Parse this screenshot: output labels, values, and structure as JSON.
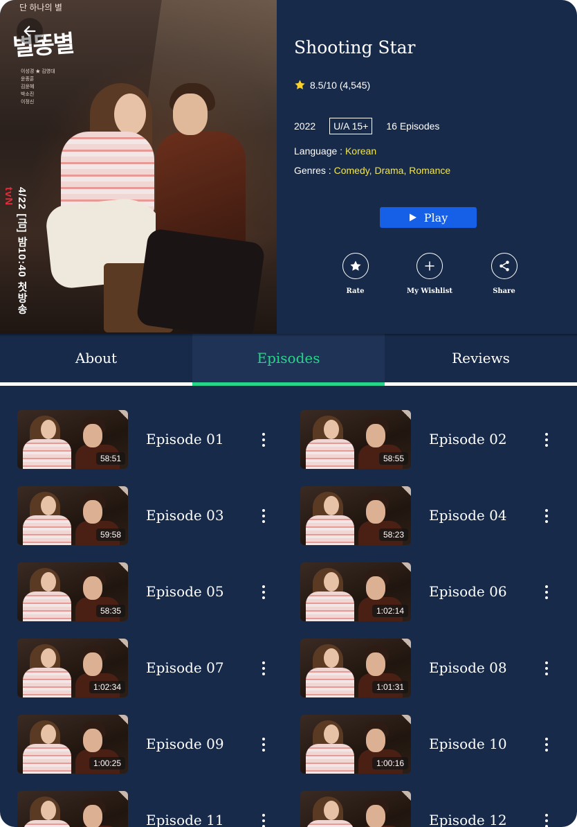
{
  "poster": {
    "top_text": "단 하나의 별",
    "logo_text": "별똥별",
    "cast": [
      "이성경 ★ 김영대",
      "윤종훈",
      "김윤혜",
      "박소진",
      "이정신"
    ],
    "air_date": "4/22 [금] 밤10:40 첫방송",
    "channel": "tvN"
  },
  "show": {
    "title": "Shooting Star",
    "rating_text": "8.5/10 (4,545)",
    "year": "2022",
    "certificate": "U/A 15+",
    "episodes_count": "16 Episodes",
    "language_label": "Language : ",
    "language": "Korean",
    "genres_label": "Genres : ",
    "genres": "Comedy, Drama, Romance"
  },
  "actions": {
    "play": "Play",
    "rate": "Rate",
    "wishlist": "My Wishlist",
    "share": "Share"
  },
  "tabs": [
    "About",
    "Episodes",
    "Reviews"
  ],
  "active_tab": "Episodes",
  "colors": {
    "background": "#172a4a",
    "accent_green": "#27d58a",
    "play_blue": "#1660e8",
    "highlight_yellow": "#f2e64f"
  },
  "icons": {
    "back": "back-arrow-icon",
    "star": "star-icon",
    "play": "play-icon",
    "rate": "star-circle-icon",
    "wishlist": "plus-icon",
    "share": "share-icon",
    "more": "more-vertical-icon"
  },
  "episodes": [
    {
      "title": "Episode 01",
      "duration": "58:51"
    },
    {
      "title": "Episode 02",
      "duration": "58:55"
    },
    {
      "title": "Episode 03",
      "duration": "59:58"
    },
    {
      "title": "Episode 04",
      "duration": "58:23"
    },
    {
      "title": "Episode 05",
      "duration": "58:35"
    },
    {
      "title": "Episode 06",
      "duration": "1:02:14"
    },
    {
      "title": "Episode 07",
      "duration": "1:02:34"
    },
    {
      "title": "Episode 08",
      "duration": "1:01:31"
    },
    {
      "title": "Episode 09",
      "duration": "1:00:25"
    },
    {
      "title": "Episode 10",
      "duration": "1:00:16"
    },
    {
      "title": "Episode 11",
      "duration": ""
    },
    {
      "title": "Episode 12",
      "duration": ""
    }
  ]
}
